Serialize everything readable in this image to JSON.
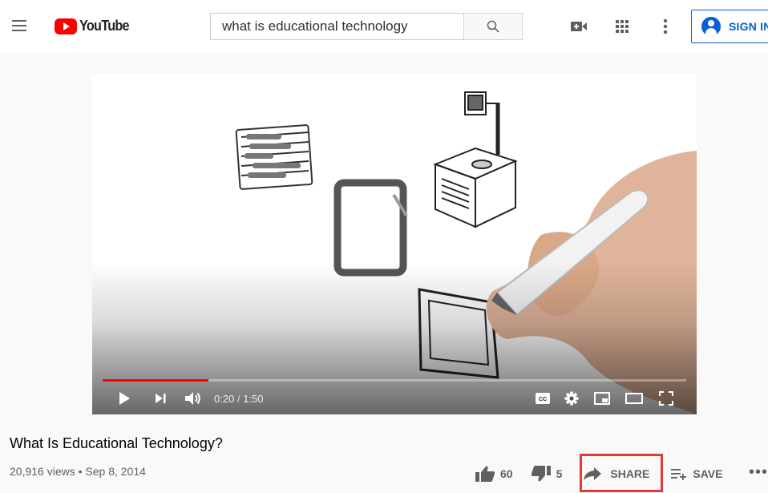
{
  "header": {
    "logo_text": "YouTube",
    "search_value": "what is educational technology",
    "signin_label": "SIGN IN"
  },
  "player": {
    "current_time": "0:20",
    "duration": "1:50",
    "progress_fraction": 0.182
  },
  "video": {
    "title": "What Is Educational Technology?",
    "meta": "20,916 views • Sep 8, 2014",
    "likes": "60",
    "dislikes": "5",
    "share_label": "SHARE",
    "save_label": "SAVE"
  },
  "colors": {
    "brand_red": "#ff0000",
    "signin_blue": "#065fd4",
    "highlight_red": "#e53935"
  }
}
